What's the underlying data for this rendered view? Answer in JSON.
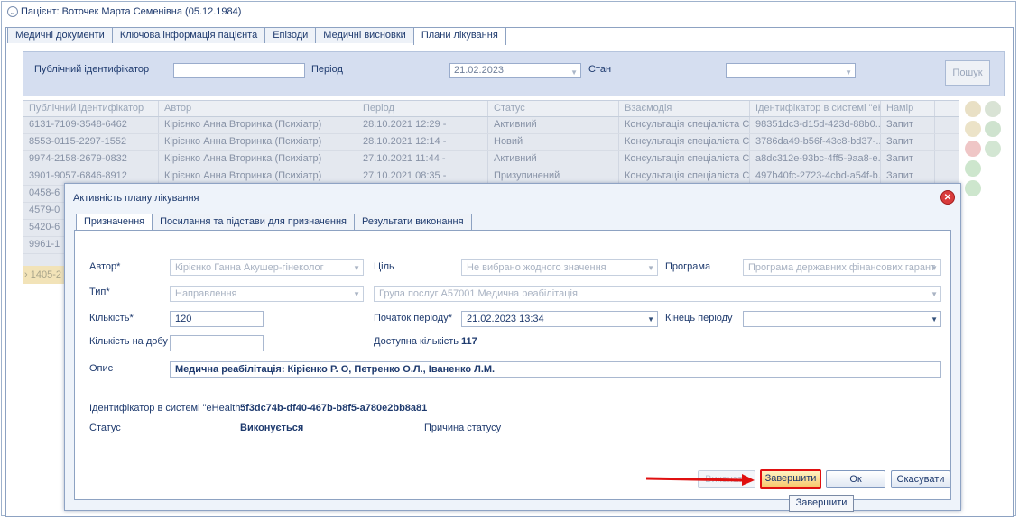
{
  "patient": {
    "title": "Пацієнт: Воточек Марта Семенівна (05.12.1984)"
  },
  "main_tabs": [
    "Медичні документи",
    "Ключова інформація пацієнта",
    "Епізоди",
    "Медичні висновки",
    "Плани лікування"
  ],
  "filter": {
    "public_id_label": "Публічний ідентифікатор",
    "period_label": "Період",
    "period_value": "21.02.2023",
    "status_label": "Стан",
    "search_button": "Пошук"
  },
  "grid": {
    "columns": [
      "Публічний ідентифікатор",
      "Автор",
      "Період",
      "Статус",
      "Взаємодія",
      "Ідентифікатор в системі \"eHe",
      "Намір"
    ],
    "rows": [
      [
        "6131-7109-3548-6462",
        "Кірієнко Анна Вторинка (Психіатр)",
        "28.10.2021 12:29 -",
        "Активний",
        "Консультація спеціаліста С...",
        "98351dc3-d15d-423d-88b0...",
        "Запит"
      ],
      [
        "8553-0115-2297-1552",
        "Кірієнко Анна Вторинка (Психіатр)",
        "28.10.2021 12:14 -",
        "Новий",
        "Консультація спеціаліста С...",
        "3786da49-b56f-43c8-bd37-...",
        "Запит"
      ],
      [
        "9974-2158-2679-0832",
        "Кірієнко Анна Вторинка (Психіатр)",
        "27.10.2021 11:44 -",
        "Активний",
        "Консультація спеціаліста С...",
        "a8dc312e-93bc-4ff5-9aa8-e...",
        "Запит"
      ],
      [
        "3901-9057-6846-8912",
        "Кірієнко Анна Вторинка (Психіатр)",
        "27.10.2021 08:35 -",
        "Призупинений",
        "Консультація спеціаліста С...",
        "497b40fc-2723-4cbd-a54f-b...",
        "Запит"
      ],
      [
        "0458-6",
        "",
        "",
        "",
        "",
        "",
        ""
      ],
      [
        "4579-0",
        "",
        "",
        "",
        "",
        "",
        ""
      ],
      [
        "5420-6",
        "",
        "",
        "",
        "",
        "",
        ""
      ],
      [
        "9961-1",
        "",
        "",
        "",
        "",
        "",
        ""
      ],
      [
        "",
        "",
        "",
        "",
        "",
        "",
        ""
      ],
      [
        "1405-2",
        "",
        "",
        "",
        "",
        "",
        ""
      ]
    ]
  },
  "dialog": {
    "title": "Активність плану лікування",
    "tabs": [
      "Призначення",
      "Посилання та підстави для призначення",
      "Результати виконання"
    ],
    "author_label": "Автор*",
    "author_value": "Кірієнко Ганна Акушер-гінеколог",
    "goal_label": "Ціль",
    "goal_value": "Не вибрано жодного значення",
    "program_label": "Програма",
    "program_value": "Програма державних фінансових гарант",
    "type_label": "Тип*",
    "type_value": "Направлення",
    "service_value": "Група послуг A57001 Медична реабілітація",
    "quantity_label": "Кількість*",
    "quantity_value": "120",
    "period_start_label": "Початок періоду*",
    "period_start_value": "21.02.2023 13:34",
    "period_end_label": "Кінець періоду",
    "per_day_label": "Кількість на добу",
    "available_label": "Доступна кількість",
    "available_value": "117",
    "description_label": "Опис",
    "description_value": "Медична реабілітація: Кірієнко Р. О, Петренко О.Л., Іваненко Л.М.",
    "ehealth_label": "Ідентифікатор в системі \"eHealth\"",
    "ehealth_value": "5f3dc74b-df40-467b-b8f5-a780e2bb8a81",
    "status_label": "Статус",
    "status_value": "Виконується",
    "status_reason_label": "Причина статусу",
    "btn_disabled": "Виконати",
    "btn_finish": "Завершити",
    "btn_ok": "Ок",
    "btn_cancel": "Скасувати",
    "tooltip": "Завершити"
  },
  "colors": {
    "highlight_border": "#e01010",
    "primary_text": "#1e3a6e"
  }
}
